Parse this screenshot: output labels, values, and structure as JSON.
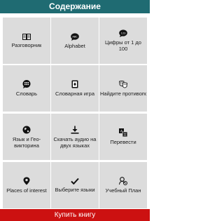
{
  "header": {
    "title": "Содержание"
  },
  "tiles": [
    {
      "label": "Разговорник",
      "icon": "book-icon"
    },
    {
      "label": "Alphabet",
      "icon": "abc-bubble-icon"
    },
    {
      "label": "Цифры от 1 до 100",
      "icon": "numbers-bubble-icon"
    },
    {
      "label": "Словарь",
      "icon": "dictionary-bubble-icon"
    },
    {
      "label": "Словарная игра",
      "icon": "card-game-icon"
    },
    {
      "label": "Найдите противоположн",
      "icon": "opposites-masks-icon"
    },
    {
      "label": "Язык и Гео-викторина",
      "icon": "globe-icon"
    },
    {
      "label": "Скачать аудио на двух языках",
      "icon": "download-icon"
    },
    {
      "label": "Перевести",
      "icon": "translate-icon"
    },
    {
      "label": "Places of interest",
      "icon": "location-pin-icon"
    },
    {
      "label": "Выберите языки",
      "icon": "checkmark-icon"
    },
    {
      "label": "Учебный План",
      "icon": "study-plan-icon"
    }
  ],
  "footer": {
    "buy_label": "Купить книгу"
  },
  "colors": {
    "header": "#1f6b72",
    "tile": "#dcdcdc",
    "footer": "#cc1111"
  }
}
